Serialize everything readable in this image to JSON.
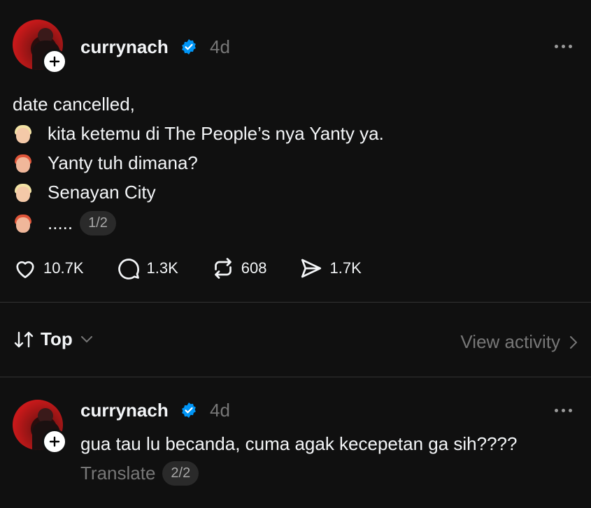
{
  "post": {
    "username": "currynach",
    "time": "4d",
    "lines": [
      {
        "emoji": "",
        "text": "date cancelled,"
      },
      {
        "emoji": "blond-person-emoji",
        "text": "kita ketemu di The People’s nya Yanty ya."
      },
      {
        "emoji": "red-hair-person-emoji",
        "text": "Yanty tuh dimana?"
      },
      {
        "emoji": "blond-person-emoji",
        "text": "Senayan City"
      },
      {
        "emoji": "red-hair-person-emoji",
        "text": "....."
      }
    ],
    "page_indicator": "1/2",
    "actions": {
      "likes": "10.7K",
      "comments": "1.3K",
      "reposts": "608",
      "shares": "1.7K"
    }
  },
  "sort": {
    "label": "Top",
    "view_activity": "View activity"
  },
  "reply": {
    "username": "currynach",
    "time": "4d",
    "text": "gua tau lu becanda, cuma agak kecepetan ga sih????",
    "translate": "Translate",
    "page_indicator": "2/2"
  },
  "colors": {
    "background": "#101010",
    "text": "#f3f5f7",
    "muted": "#777777",
    "verified": "#0095f6"
  }
}
